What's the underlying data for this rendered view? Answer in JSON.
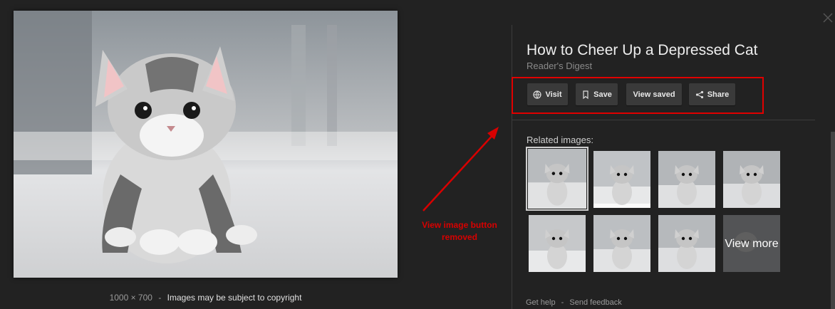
{
  "main_image": {
    "alt": "Kitten",
    "dimensions": "1000 × 700",
    "copyright": "Images may be subject to copyright",
    "separator": "-"
  },
  "panel": {
    "title": "How to Cheer Up a Depressed Cat",
    "source": "Reader's Digest",
    "buttons": [
      {
        "label": "Visit",
        "icon": "globe-icon"
      },
      {
        "label": "Save",
        "icon": "bookmark-icon"
      },
      {
        "label": "View saved",
        "icon": ""
      },
      {
        "label": "Share",
        "icon": "share-icon"
      }
    ],
    "related_label": "Related images:",
    "view_more": "View more",
    "thumb_count": 8
  },
  "annotation": {
    "text": "View image button removed",
    "color": "#d80000"
  },
  "footer": {
    "help": "Get help",
    "separator": "-",
    "feedback": "Send feedback"
  },
  "colors": {
    "background": "#222222",
    "button": "#3a3a3a",
    "highlight": "#e00000"
  }
}
